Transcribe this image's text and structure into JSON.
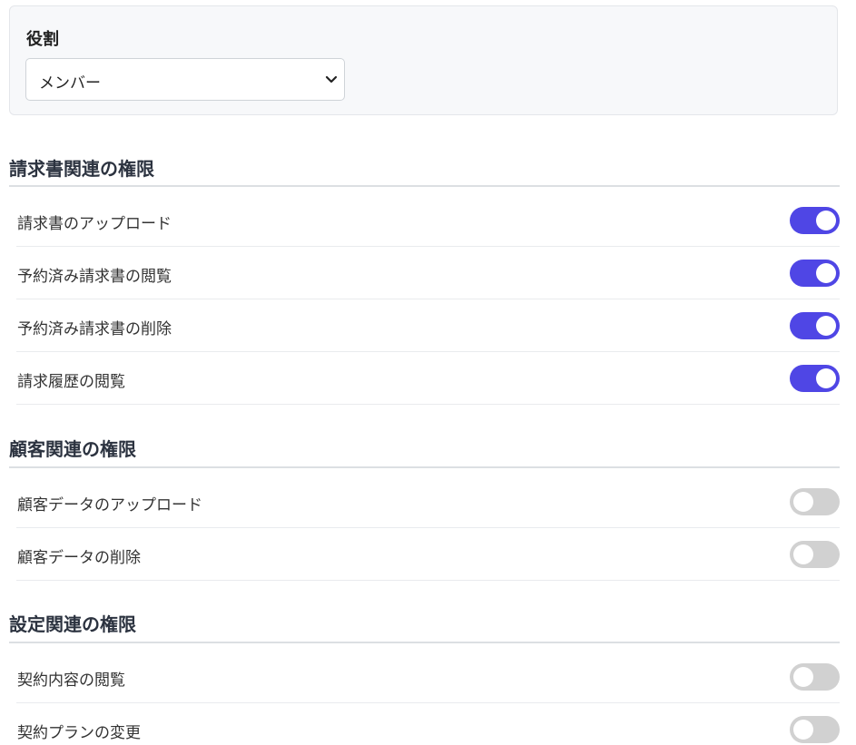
{
  "role": {
    "label": "役割",
    "selected": "メンバー"
  },
  "sections": [
    {
      "title": "請求書関連の権限",
      "items": [
        {
          "label": "請求書のアップロード",
          "enabled": true
        },
        {
          "label": "予約済み請求書の閲覧",
          "enabled": true
        },
        {
          "label": "予約済み請求書の削除",
          "enabled": true
        },
        {
          "label": "請求履歴の閲覧",
          "enabled": true
        }
      ]
    },
    {
      "title": "顧客関連の権限",
      "items": [
        {
          "label": "顧客データのアップロード",
          "enabled": false
        },
        {
          "label": "顧客データの削除",
          "enabled": false
        }
      ]
    },
    {
      "title": "設定関連の権限",
      "items": [
        {
          "label": "契約内容の閲覧",
          "enabled": false
        },
        {
          "label": "契約プランの変更",
          "enabled": false
        }
      ]
    }
  ],
  "colors": {
    "toggle_on": "#4f46e5",
    "toggle_off": "#d1d1d1"
  }
}
